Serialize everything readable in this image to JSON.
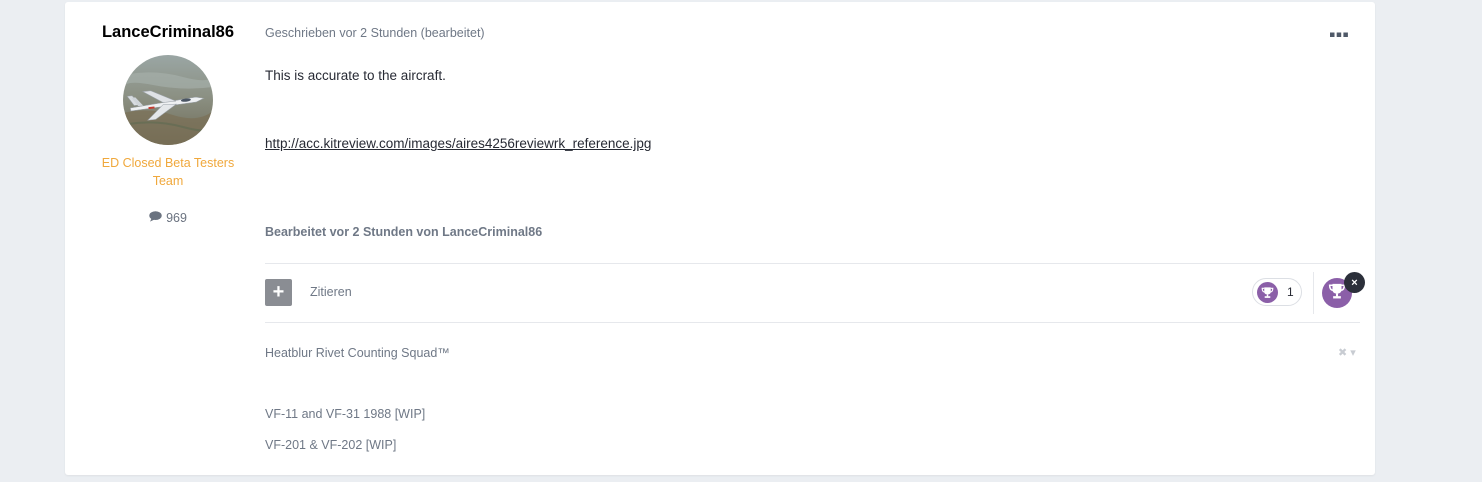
{
  "author": {
    "name": "LanceCriminal86",
    "group": "ED Closed Beta Testers Team",
    "post_count": "969",
    "avatar_icon": "jet-aircraft-avatar",
    "post_count_icon": "speech-bubble-icon"
  },
  "post": {
    "meta": "Geschrieben vor 2 Stunden (bearbeitet)",
    "content": "This is accurate to the aircraft.",
    "link": "http://acc.kitreview.com/images/aires4256reviewrk_reference.jpg",
    "edited": "Bearbeitet vor 2 Stunden von LanceCriminal86",
    "menu_icon": "more-dots-icon"
  },
  "actions": {
    "plus_label": "+",
    "quote_label": "Zitieren",
    "reaction_count": "1",
    "reaction_icon": "trophy-icon",
    "remove_label": "×"
  },
  "signature": {
    "line1": "Heatblur Rivet Counting Squad™",
    "line2": "VF-11 and VF-31 1988 [WIP]",
    "line3": "VF-201 & VF-202 [WIP]",
    "controls_label": "✖ ▾"
  },
  "colors": {
    "page_bg": "#ebeef2",
    "group_color": "#f0a83c",
    "reaction_purple": "#8b5fa8"
  }
}
